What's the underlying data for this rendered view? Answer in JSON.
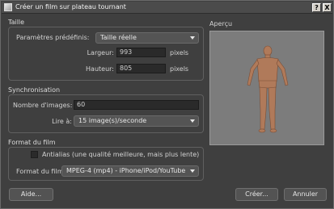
{
  "window": {
    "title": "Créer un film sur plateau tournant",
    "help_label": "?",
    "close_label": "X"
  },
  "taille": {
    "title": "Taille",
    "preset_label": "Paramètres prédéfinis:",
    "preset_value": "Taille réelle",
    "width_label": "Largeur:",
    "width_value": "993",
    "width_unit": "pixels",
    "height_label": "Hauteur:",
    "height_value": "805",
    "height_unit": "pixels"
  },
  "synchro": {
    "title": "Synchronisation",
    "frames_label": "Nombre d'images:",
    "frames_value": "60",
    "rate_label": "Lire à:",
    "rate_value": "15 image(s)/seconde"
  },
  "format": {
    "title": "Format du film",
    "antialias_label": "Antialias (une qualité meilleure, mais plus lente)",
    "antialias_checked": false,
    "format_label": "Format du film:",
    "format_value": "MPEG-4 (mp4) - iPhone/iPod/YouTube"
  },
  "preview": {
    "title": "Aperçu",
    "background": "#7c7c7c",
    "figure_color": "#b07a5a"
  },
  "buttons": {
    "help": "Aide...",
    "create": "Créer...",
    "cancel": "Annuler"
  }
}
